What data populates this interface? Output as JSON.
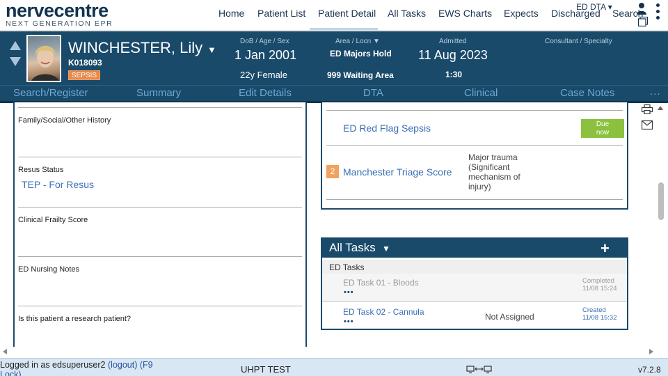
{
  "brand": {
    "name": "nervecentre",
    "tagline": "NEXT GENERATION EPR"
  },
  "nav": {
    "items": [
      "Home",
      "Patient List",
      "Patient Detail",
      "All Tasks",
      "EWS Charts",
      "Expects",
      "Discharged",
      "Search"
    ],
    "active": "Patient Detail",
    "context_label": "ED DTA ▾"
  },
  "patient": {
    "name": "WINCHESTER, Lily",
    "id": "K018093",
    "alert": "SEPSIS",
    "dob_label": "DoB / Age / Sex",
    "dob": "1 Jan 2001",
    "age_sex": "22y Female",
    "area_label": "Area / Locn",
    "area": "ED Majors Hold",
    "location": "999 Waiting Area",
    "admitted_label": "Admitted",
    "admitted_date": "11 Aug 2023",
    "admitted_time": "1:30",
    "consultant_label": "Consultant / Specialty"
  },
  "subnav": {
    "items": [
      "Search/Register",
      "Summary",
      "Edit Details",
      "DTA",
      "Clinical",
      "Case Notes"
    ],
    "more": "..."
  },
  "left_panel": {
    "sections": [
      {
        "label": "Family/Social/Other History",
        "value": ""
      },
      {
        "label": "Resus Status",
        "value": "TEP - For Resus"
      },
      {
        "label": "Clinical Frailty Score",
        "value": ""
      },
      {
        "label": "ED Nursing Notes",
        "value": ""
      },
      {
        "label": "Is this patient a research patient?",
        "value": ""
      }
    ]
  },
  "triage": {
    "sepsis_label": "ED Red Flag Sepsis",
    "sepsis_status": "Due now",
    "mts_score": "2",
    "mts_label": "Manchester Triage Score",
    "mts_desc": "Major trauma (Significant mechanism of injury)"
  },
  "tasks": {
    "title": "All Tasks",
    "add_label": "+",
    "group": "ED Tasks",
    "items": [
      {
        "name": "ED Task 01 - Bloods",
        "assigned": "",
        "status": "Completed",
        "time": "11/08 15:24"
      },
      {
        "name": "ED Task 02 - Cannula",
        "assigned": "Not Assigned",
        "status": "Created",
        "time": "11/08 15:32"
      }
    ]
  },
  "status": {
    "login_prefix": "Logged in as edsuperuser2",
    "logout": "(logout)",
    "lock": "(F9 Lock)",
    "environment": "UHPT TEST",
    "version": "v7.2.8"
  },
  "colors": {
    "banner": "#1a4a6a",
    "link": "#3a6fb5",
    "alert": "#e8894a",
    "due": "#8bc13f"
  }
}
